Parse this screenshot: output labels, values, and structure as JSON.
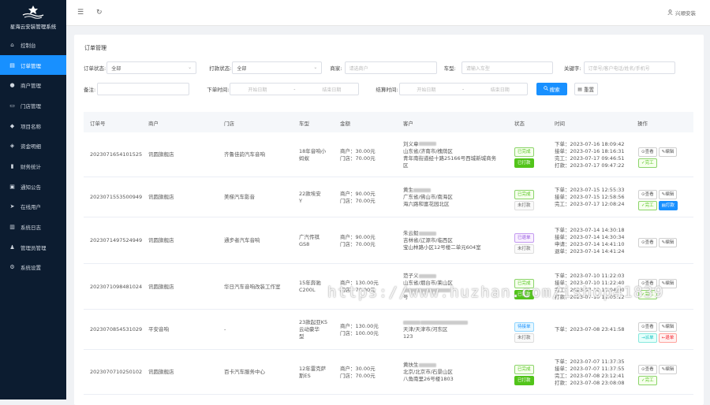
{
  "app": {
    "title": "星海云安装管理系统"
  },
  "sidebar": {
    "items": [
      {
        "label": "控制台",
        "icon": "home-icon"
      },
      {
        "label": "订单管理",
        "icon": "order-icon",
        "active": true
      },
      {
        "label": "商户管理",
        "icon": "user-icon"
      },
      {
        "label": "门店管理",
        "icon": "store-icon"
      },
      {
        "label": "项目名称",
        "icon": "project-icon"
      },
      {
        "label": "资金明细",
        "icon": "money-icon"
      },
      {
        "label": "财务统计",
        "icon": "chart-icon"
      },
      {
        "label": "通知公告",
        "icon": "notice-icon"
      },
      {
        "label": "在线用户",
        "icon": "online-icon"
      },
      {
        "label": "系统日志",
        "icon": "log-icon"
      },
      {
        "label": "管理员管理",
        "icon": "admin-icon"
      },
      {
        "label": "系统设置",
        "icon": "gear-icon"
      }
    ]
  },
  "topbar": {
    "user": "兴顺安装"
  },
  "page": {
    "title": "订单管理"
  },
  "filters": {
    "order_status_label": "订单状态:",
    "order_status_value": "全部",
    "pay_status_label": "打款状态:",
    "pay_status_value": "全部",
    "merchant_label": "商家:",
    "merchant_placeholder": "请选商户",
    "car_label": "车型:",
    "car_placeholder": "请输入车型",
    "keyword_label": "关键字:",
    "keyword_placeholder": "订单号/客户电话/姓名/手机号",
    "remark_label": "备注:",
    "order_time_label": "下单时间:",
    "order_start": "开始日期",
    "order_end": "结束日期",
    "settle_time_label": "结算时间:",
    "settle_start": "开始日期",
    "settle_end": "结束日期",
    "search_label": "搜索",
    "reset_label": "重置"
  },
  "table": {
    "headers": [
      "订单号",
      "商户",
      "门店",
      "车型",
      "金额",
      "客户",
      "状态",
      "时间",
      "操作"
    ],
    "rows": [
      {
        "order_no": "2023071654101525",
        "merchant": "讯圆旗舰店",
        "store": "齐鲁佳韵汽车音响",
        "car": [
          "18年音响小",
          "蚂蚁"
        ],
        "amount": [
          "商户：30.00元",
          "门店：70.00元"
        ],
        "customer": [
          "刘义章",
          "山东省/济南市/槐荫区",
          "青年南街道经十路25166号西城新城商务",
          "区"
        ],
        "status": [
          {
            "t": "已完成",
            "c": "green"
          },
          {
            "t": "已打款",
            "c": "greenf"
          }
        ],
        "times": [
          "下单：2023-07-16 18:09:42",
          "接单：2023-07-16 18:16:31",
          "完工：2023-07-17 09:46:51",
          "打款：2023-07-17 09:47:22"
        ],
        "ops": [
          {
            "t": "查看",
            "c": ""
          },
          {
            "t": "编辑",
            "c": ""
          },
          {
            "t": "完工",
            "c": "g"
          }
        ]
      },
      {
        "order_no": "2023071553500949",
        "merchant": "讯圆旗舰店",
        "store": "美梯汽车影音",
        "car": [
          "22款埃安",
          "Y"
        ],
        "amount": [
          "商户：90.00元",
          "门店：70.00元"
        ],
        "customer": [
          "黄生",
          "广东省/佛山市/南海区",
          "海六路和富花园北区"
        ],
        "status": [
          {
            "t": "已完成",
            "c": "green"
          },
          {
            "t": "未打款",
            "c": "gray"
          }
        ],
        "times": [
          "下单：2023-07-15 12:55:33",
          "接单：2023-07-15 12:58:56",
          "完工：2023-07-17 12:08:24"
        ],
        "ops": [
          {
            "t": "查看",
            "c": ""
          },
          {
            "t": "编辑",
            "c": ""
          },
          {
            "t": "完工",
            "c": "g"
          },
          {
            "t": "打款",
            "c": "bl"
          }
        ]
      },
      {
        "order_no": "2023071497524949",
        "merchant": "讯圆旗舰店",
        "store": "通步者汽车音响",
        "car": [
          "广汽传祺",
          "GS8"
        ],
        "amount": [
          "商户：90.00元",
          "门店：70.00元"
        ],
        "customer": [
          "朱云毅",
          "吉林省/辽源市/临西区",
          "宝山林路小区12号楼二单元604室"
        ],
        "status": [
          {
            "t": "已退单",
            "c": "purple"
          },
          {
            "t": "未打款",
            "c": "gray"
          }
        ],
        "times": [
          "下单：2023-07-14 14:30:18",
          "接单：2023-07-14 14:30:34",
          "申请：2023-07-14 14:41:10",
          "退单：2023-07-14 14:41:24"
        ],
        "ops": [
          {
            "t": "查看",
            "c": ""
          },
          {
            "t": "编辑",
            "c": ""
          }
        ]
      },
      {
        "order_no": "2023071098481024",
        "merchant": "讯圆旗舰店",
        "store": "华日汽车音响改装工作室",
        "car": [
          "15年奔驰",
          "C200L"
        ],
        "amount": [
          "商户：130.00元",
          "门店：70.00元"
        ],
        "customer": [
          "范子义",
          "山东省/烟台市/莱山区",
          "",
          "号"
        ],
        "status": [
          {
            "t": "已完成",
            "c": "green"
          },
          {
            "t": "已打款",
            "c": "greenf"
          }
        ],
        "times": [
          "下单：2023-07-10 11:22:03",
          "接单：2023-07-10 11:22:40",
          "完工：2023-07-10 12:04:00",
          "打款：2023-07-10 12:05:12"
        ],
        "ops": [
          {
            "t": "查看",
            "c": ""
          },
          {
            "t": "编辑",
            "c": ""
          },
          {
            "t": "完工",
            "c": "g"
          }
        ]
      },
      {
        "order_no": "2023070854531029",
        "merchant": "平安音响",
        "store": "-",
        "car": [
          "23款起亚K5",
          "云动豪华",
          "型"
        ],
        "amount": [
          "商户：130.00元",
          "门店：100.00元"
        ],
        "customer": [
          "",
          "天津/天津市/河东区",
          "123"
        ],
        "status": [
          {
            "t": "待接单",
            "c": "blue"
          },
          {
            "t": "未打款",
            "c": "gray"
          }
        ],
        "times": [
          "下单：2023-07-08 23:41:58"
        ],
        "ops": [
          {
            "t": "查看",
            "c": ""
          },
          {
            "t": "编辑",
            "c": ""
          },
          {
            "t": "派单",
            "c": "cy"
          },
          {
            "t": "退单",
            "c": "r"
          }
        ]
      },
      {
        "order_no": "2023070710250102",
        "merchant": "讯圆旗舰店",
        "store": "百卡汽车服务中心",
        "car": [
          "12年雷克萨",
          "斯ES"
        ],
        "amount": [
          "商户：30.00元",
          "门店：70.00元"
        ],
        "customer": [
          "黄扶生",
          "北京/北京市/石景山区",
          "八角南里26号楼1803"
        ],
        "status": [
          {
            "t": "已完成",
            "c": "green"
          },
          {
            "t": "已打款",
            "c": "greenf"
          }
        ],
        "times": [
          "下单：2023-07-07 11:37:35",
          "接单：2023-07-07 11:37:55",
          "完工：2023-07-08 23:12:41",
          "打款：2023-07-08 23:08:08"
        ],
        "ops": [
          {
            "t": "查看",
            "c": ""
          },
          {
            "t": "编辑",
            "c": ""
          },
          {
            "t": "完工",
            "c": "g"
          }
        ]
      }
    ]
  },
  "watermark": "https://www.huzhan.com/ishop41839"
}
